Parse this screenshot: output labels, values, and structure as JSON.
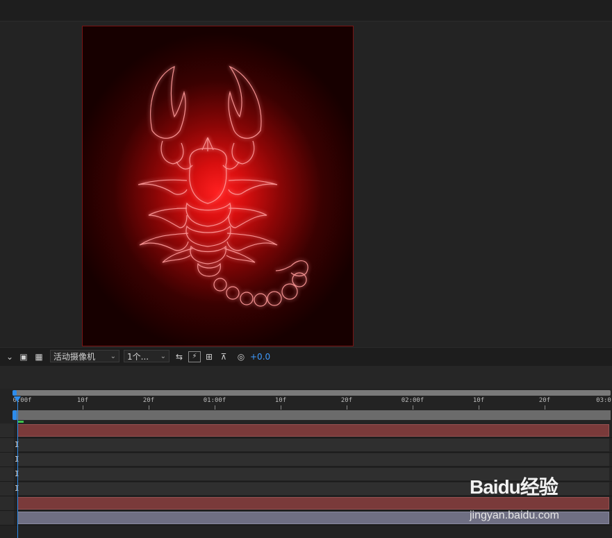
{
  "viewer": {
    "icons": [
      "chevron-down-icon",
      "region-of-interest-icon",
      "transparency-grid-icon"
    ],
    "camera_dropdown": {
      "value": "活动摄像机"
    },
    "view_dropdown": {
      "value": "1个..."
    },
    "toolbar_icons": [
      "3d-draft-icon",
      "fast-preview-icon",
      "timeline-flow-icon",
      "flowchart-icon",
      "exposure-reset-icon"
    ],
    "exposure": "+0.0"
  },
  "timeline": {
    "ruler_labels": [
      "0:00f",
      "10f",
      "20f",
      "01:00f",
      "10f",
      "20f",
      "02:00f",
      "10f",
      "20f",
      "03:0"
    ],
    "playhead_frame": 0,
    "tracks": [
      {
        "type": "layer-red"
      },
      {
        "type": "property",
        "marker": "I"
      },
      {
        "type": "property",
        "marker": "I"
      },
      {
        "type": "property",
        "marker": "I"
      },
      {
        "type": "property",
        "marker": "I"
      },
      {
        "type": "layer-red"
      },
      {
        "type": "layer-purple"
      }
    ]
  },
  "watermark": {
    "logo_text": "Baidu经验",
    "url": "jingyan.baidu.com"
  },
  "colors": {
    "accent": "#2d8ceb",
    "glow": "#ff2020",
    "layer_red": "#7a3a3a",
    "layer_purple": "#6f6f83"
  }
}
